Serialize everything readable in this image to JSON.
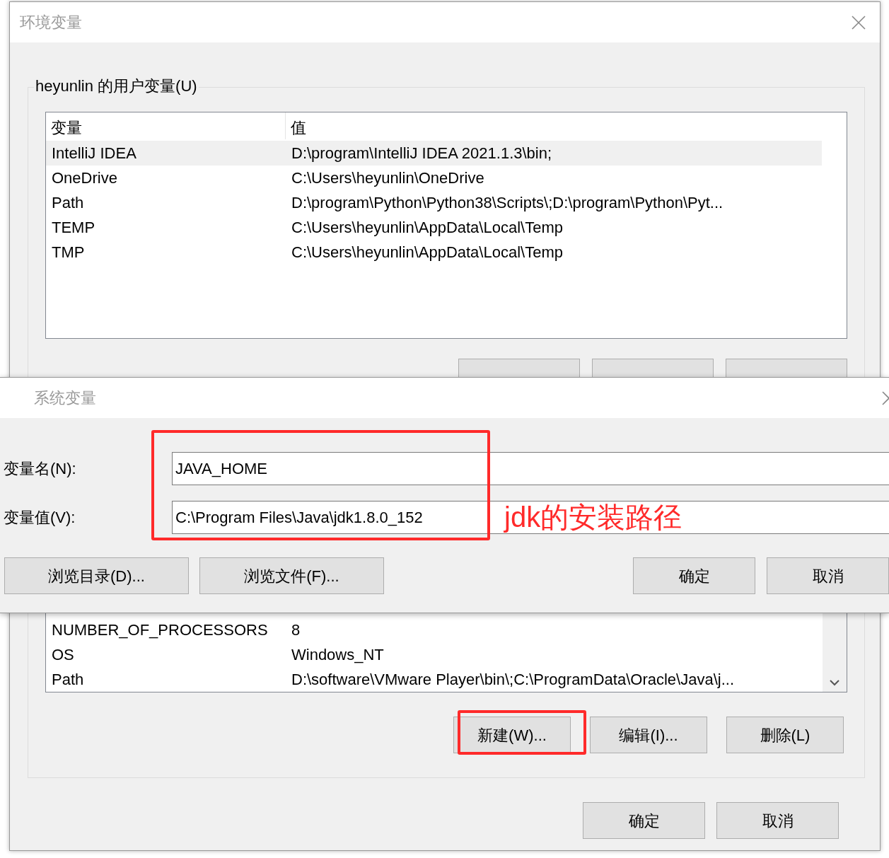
{
  "env_window": {
    "title": "环境变量",
    "user_group": {
      "legend": "heyunlin 的用户变量(U)",
      "columns": [
        "变量",
        "值"
      ],
      "rows": [
        {
          "name": "IntelliJ IDEA",
          "value": "D:\\program\\IntelliJ IDEA 2021.1.3\\bin;",
          "selected": true
        },
        {
          "name": "OneDrive",
          "value": "C:\\Users\\heyunlin\\OneDrive",
          "selected": false
        },
        {
          "name": "Path",
          "value": "D:\\program\\Python\\Python38\\Scripts\\;D:\\program\\Python\\Pyt...",
          "selected": false
        },
        {
          "name": "TEMP",
          "value": "C:\\Users\\heyunlin\\AppData\\Local\\Temp",
          "selected": false
        },
        {
          "name": "TMP",
          "value": "C:\\Users\\heyunlin\\AppData\\Local\\Temp",
          "selected": false
        }
      ],
      "buttons": [
        {
          "kind": "button"
        },
        {
          "kind": "button"
        },
        {
          "kind": "button"
        }
      ]
    },
    "system_group": {
      "rows": [
        {
          "name": "NUMBER_OF_PROCESSORS",
          "value": "8"
        },
        {
          "name": "OS",
          "value": "Windows_NT"
        },
        {
          "name": "Path",
          "value": "D:\\software\\VMware Player\\bin\\;C:\\ProgramData\\Oracle\\Java\\j..."
        }
      ],
      "buttons": [
        "新建(W)...",
        "编辑(I)...",
        "删除(L)"
      ]
    },
    "buttons": [
      "确定",
      "取消"
    ]
  },
  "new_variable_dialog": {
    "title": "系统变量",
    "fields": [
      {
        "label": "变量名(N):",
        "value": "JAVA_HOME"
      },
      {
        "label": "变量值(V):",
        "value": "C:\\Program Files\\Java\\jdk1.8.0_152"
      }
    ],
    "left_buttons": [
      "浏览目录(D)...",
      "浏览文件(F)..."
    ],
    "right_buttons": [
      "确定",
      "取消"
    ]
  },
  "annotation": {
    "text": "jdk的安装路径"
  }
}
